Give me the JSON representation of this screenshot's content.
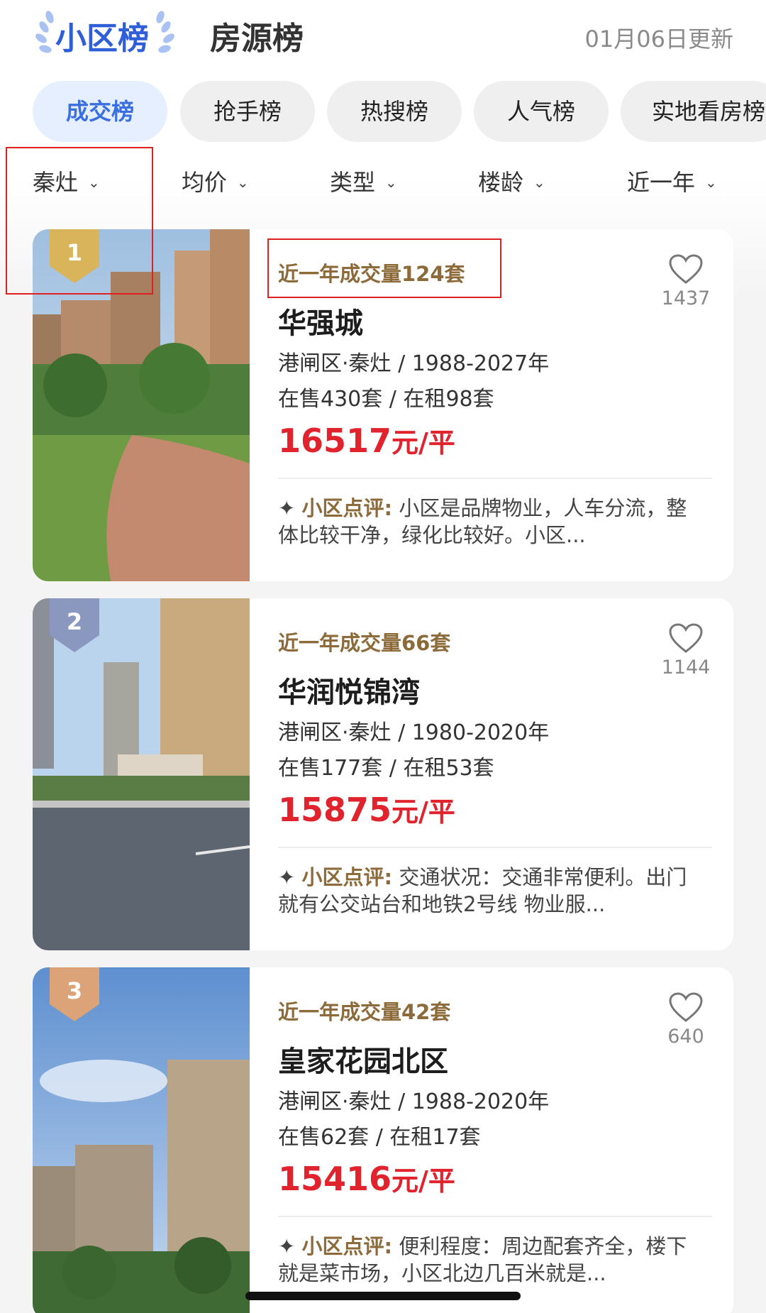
{
  "header": {
    "tab_primary": "小区榜",
    "tab_secondary": "房源榜",
    "updated": "01月06日更新"
  },
  "categories": [
    "成交榜",
    "抢手榜",
    "热搜榜",
    "人气榜",
    "实地看房榜"
  ],
  "filters": [
    "秦灶",
    "均价",
    "类型",
    "楼龄",
    "近一年"
  ],
  "review_label": "小区点评:",
  "price_unit": "元/平",
  "colors": {
    "accent": "#3a6fe0",
    "price": "#e0232c",
    "deal": "#8c6a3a"
  },
  "listings": [
    {
      "rank": "1",
      "deal": "近一年成交量124套",
      "name": "华强城",
      "location": "港闸区·秦灶 / 1988-2027年",
      "stock": "在售430套 / 在租98套",
      "price": "16517",
      "review": "小区是品牌物业，人车分流，整体比较干净，绿化比较好。小区...",
      "favorites": "1437"
    },
    {
      "rank": "2",
      "deal": "近一年成交量66套",
      "name": "华润悦锦湾",
      "location": "港闸区·秦灶 / 1980-2020年",
      "stock": "在售177套 / 在租53套",
      "price": "15875",
      "review": "交通状况：交通非常便利。出门就有公交站台和地铁2号线 物业服...",
      "favorites": "1144"
    },
    {
      "rank": "3",
      "deal": "近一年成交量42套",
      "name": "皇家花园北区",
      "location": "港闸区·秦灶 / 1988-2020年",
      "stock": "在售62套 / 在租17套",
      "price": "15416",
      "review": "便利程度：周边配套齐全，楼下就是菜市场，小区北边几百米就是...",
      "favorites": "640"
    }
  ]
}
